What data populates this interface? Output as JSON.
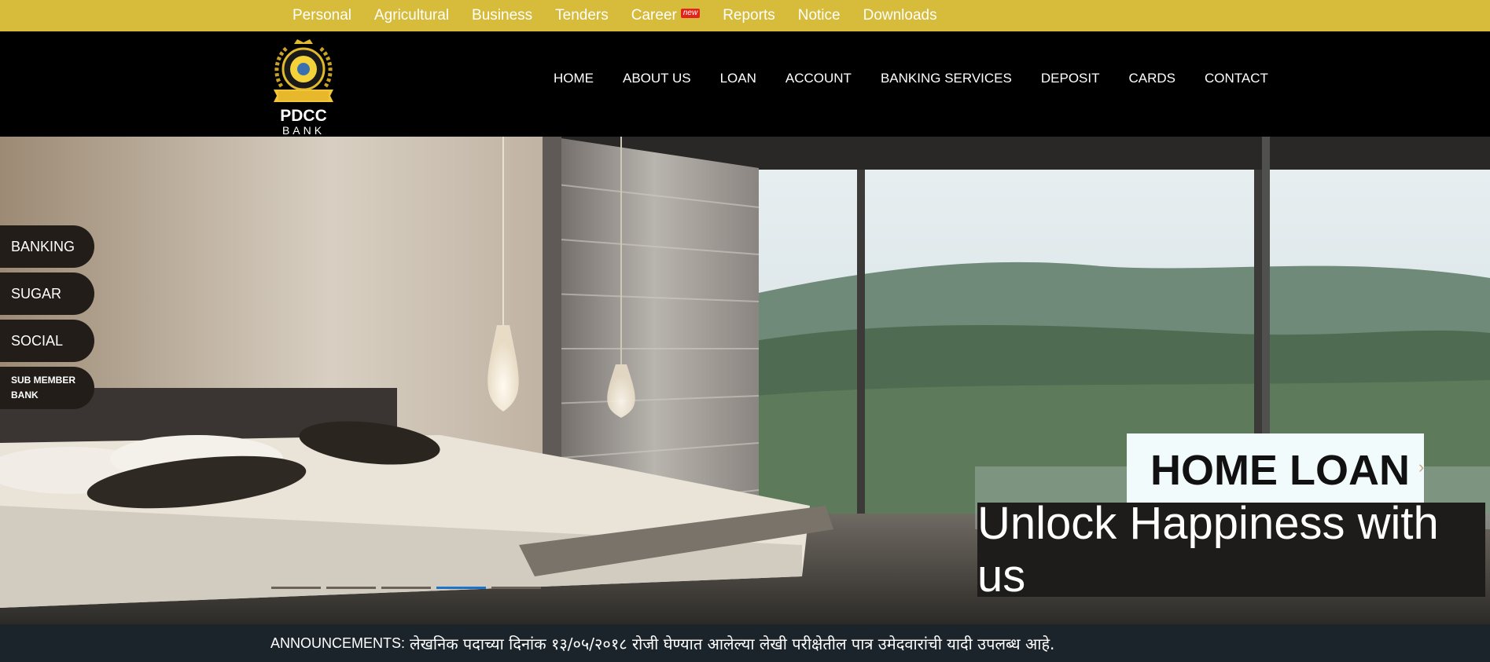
{
  "topbar": {
    "items": [
      {
        "label": "Personal"
      },
      {
        "label": "Agricultural"
      },
      {
        "label": "Business"
      },
      {
        "label": "Tenders"
      },
      {
        "label": "Career",
        "badge": "new"
      },
      {
        "label": "Reports"
      },
      {
        "label": "Notice"
      },
      {
        "label": "Downloads"
      }
    ],
    "background": "#d7bb3b"
  },
  "logo": {
    "main": "PDCC",
    "sub": "BANK"
  },
  "nav": {
    "items": [
      "HOME",
      "ABOUT US",
      "LOAN",
      "ACCOUNT",
      "BANKING SERVICES",
      "DEPOSIT",
      "CARDS",
      "CONTACT"
    ]
  },
  "sidetabs": [
    "BANKING",
    "SUGAR",
    "SOCIAL",
    "SUB MEMBER BANK"
  ],
  "slide": {
    "title": "HOME LOAN",
    "subtitle": "Unlock Happiness with us",
    "next_icon": "chevron-right-icon",
    "indicator_count": 5,
    "active_indicator": 4
  },
  "announcement": {
    "label": "ANNOUNCEMENTS:",
    "text": "लेखनिक पदाच्या दिनांक १३/०५/२०१८ रोजी घेण्यात आलेल्या लेखी परीक्षेतील पात्र उमेदवारांची यादी उपलब्ध आहे."
  }
}
